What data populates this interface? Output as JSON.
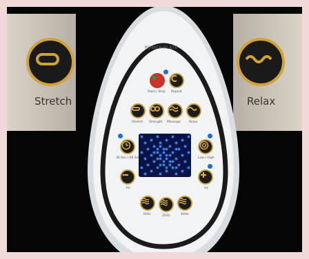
{
  "side_left": {
    "label": "Stretch"
  },
  "side_right": {
    "label": "Relax"
  },
  "device": {
    "brand": "POWER PLATE",
    "row1": [
      "Start / Stop",
      "Repeat"
    ],
    "row2": [
      "Stretch",
      "Strength",
      "Massage",
      "Relax"
    ],
    "timer_label": "30 Sec / 60 Sec",
    "intensity_label": "Low / High",
    "minus_label": "Hz",
    "plus_label": "Hz",
    "row3": [
      "30Hz",
      "35Hz",
      "40Hz"
    ]
  }
}
